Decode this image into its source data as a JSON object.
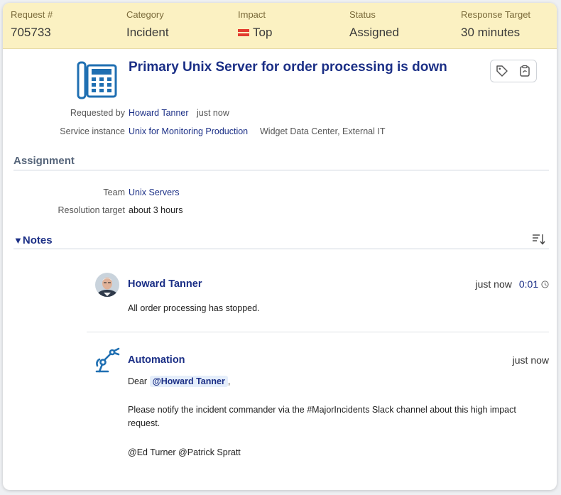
{
  "summary": {
    "request_label": "Request #",
    "request_value": "705733",
    "category_label": "Category",
    "category_value": "Incident",
    "impact_label": "Impact",
    "impact_value": "Top",
    "status_label": "Status",
    "status_value": "Assigned",
    "response_label": "Response Target",
    "response_value": "30 minutes"
  },
  "request": {
    "title": "Primary Unix Server for order processing is down",
    "requested_by_label": "Requested by",
    "requested_by": "Howard Tanner",
    "requested_when": "just now",
    "service_instance_label": "Service instance",
    "service_instance": "Unix for Monitoring Production",
    "service_instance_extra": "Widget Data Center, External IT"
  },
  "assignment": {
    "heading": "Assignment",
    "team_label": "Team",
    "team": "Unix Servers",
    "resolution_label": "Resolution target",
    "resolution": "about 3 hours"
  },
  "notes": {
    "heading": "Notes",
    "toggle": "▼",
    "items": [
      {
        "author": "Howard Tanner",
        "time": "just now",
        "duration": "0:01",
        "text": "All order processing has stopped."
      },
      {
        "author": "Automation",
        "time": "just now",
        "greeting": "Dear",
        "mention": "@Howard Tanner",
        "greeting_end": ",",
        "paragraph": "Please notify the incident commander via the #MajorIncidents Slack channel about this high impact request.",
        "signoff": "@Ed Turner @Patrick Spratt"
      }
    ]
  },
  "colors": {
    "summary_bg": "#fbf1c2",
    "accent": "#1b2f86",
    "impact_top": "#e23b2e"
  },
  "icons": {
    "request_type": "desk-phone-icon",
    "tag": "tag-icon",
    "clipboard": "clipboard-icon",
    "sort": "sort-icon",
    "automation": "robot-arm-icon"
  }
}
